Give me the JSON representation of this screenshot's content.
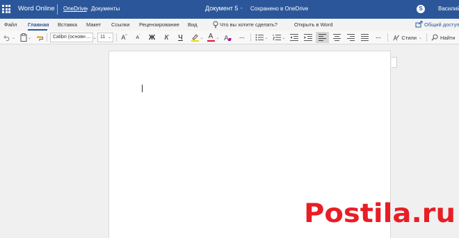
{
  "titlebar": {
    "app_name": "Word Online",
    "breadcrumb_link": "OneDrive",
    "breadcrumb_chevron": "›",
    "breadcrumb_folder": "Документы",
    "document_name": "Документ 5",
    "separator": "-",
    "save_status": "Сохранено в OneDrive",
    "user_name": "Василий",
    "bar_color": "#2b579a",
    "icons": [
      "app-launcher-icon",
      "skype-icon"
    ]
  },
  "menu": {
    "items": [
      "Файл",
      "Главная",
      "Вставка",
      "Макет",
      "Ссылки",
      "Рецензирование",
      "Вид"
    ],
    "active": "Главная",
    "tell_me": "Что вы хотите сделать?",
    "open_in_word": "Открыть в Word",
    "share": "Общий доступ",
    "accent_color": "#2b579a"
  },
  "ribbon": {
    "font_name": "Calibri (основн ...",
    "font_size": "11",
    "bold_label": "Ж",
    "italic_label": "К",
    "underline_label": "Ч",
    "styles_label": "Стили",
    "find_label": "Найти",
    "grow_label": "A",
    "shrink_label": "A",
    "font_color_label": "A",
    "more_label": "···",
    "active_alignment": "left",
    "highlight_color": "#f5d800",
    "font_color": "#e81123"
  },
  "watermark": {
    "text": "Postila.ru",
    "color": "#e81e25"
  }
}
